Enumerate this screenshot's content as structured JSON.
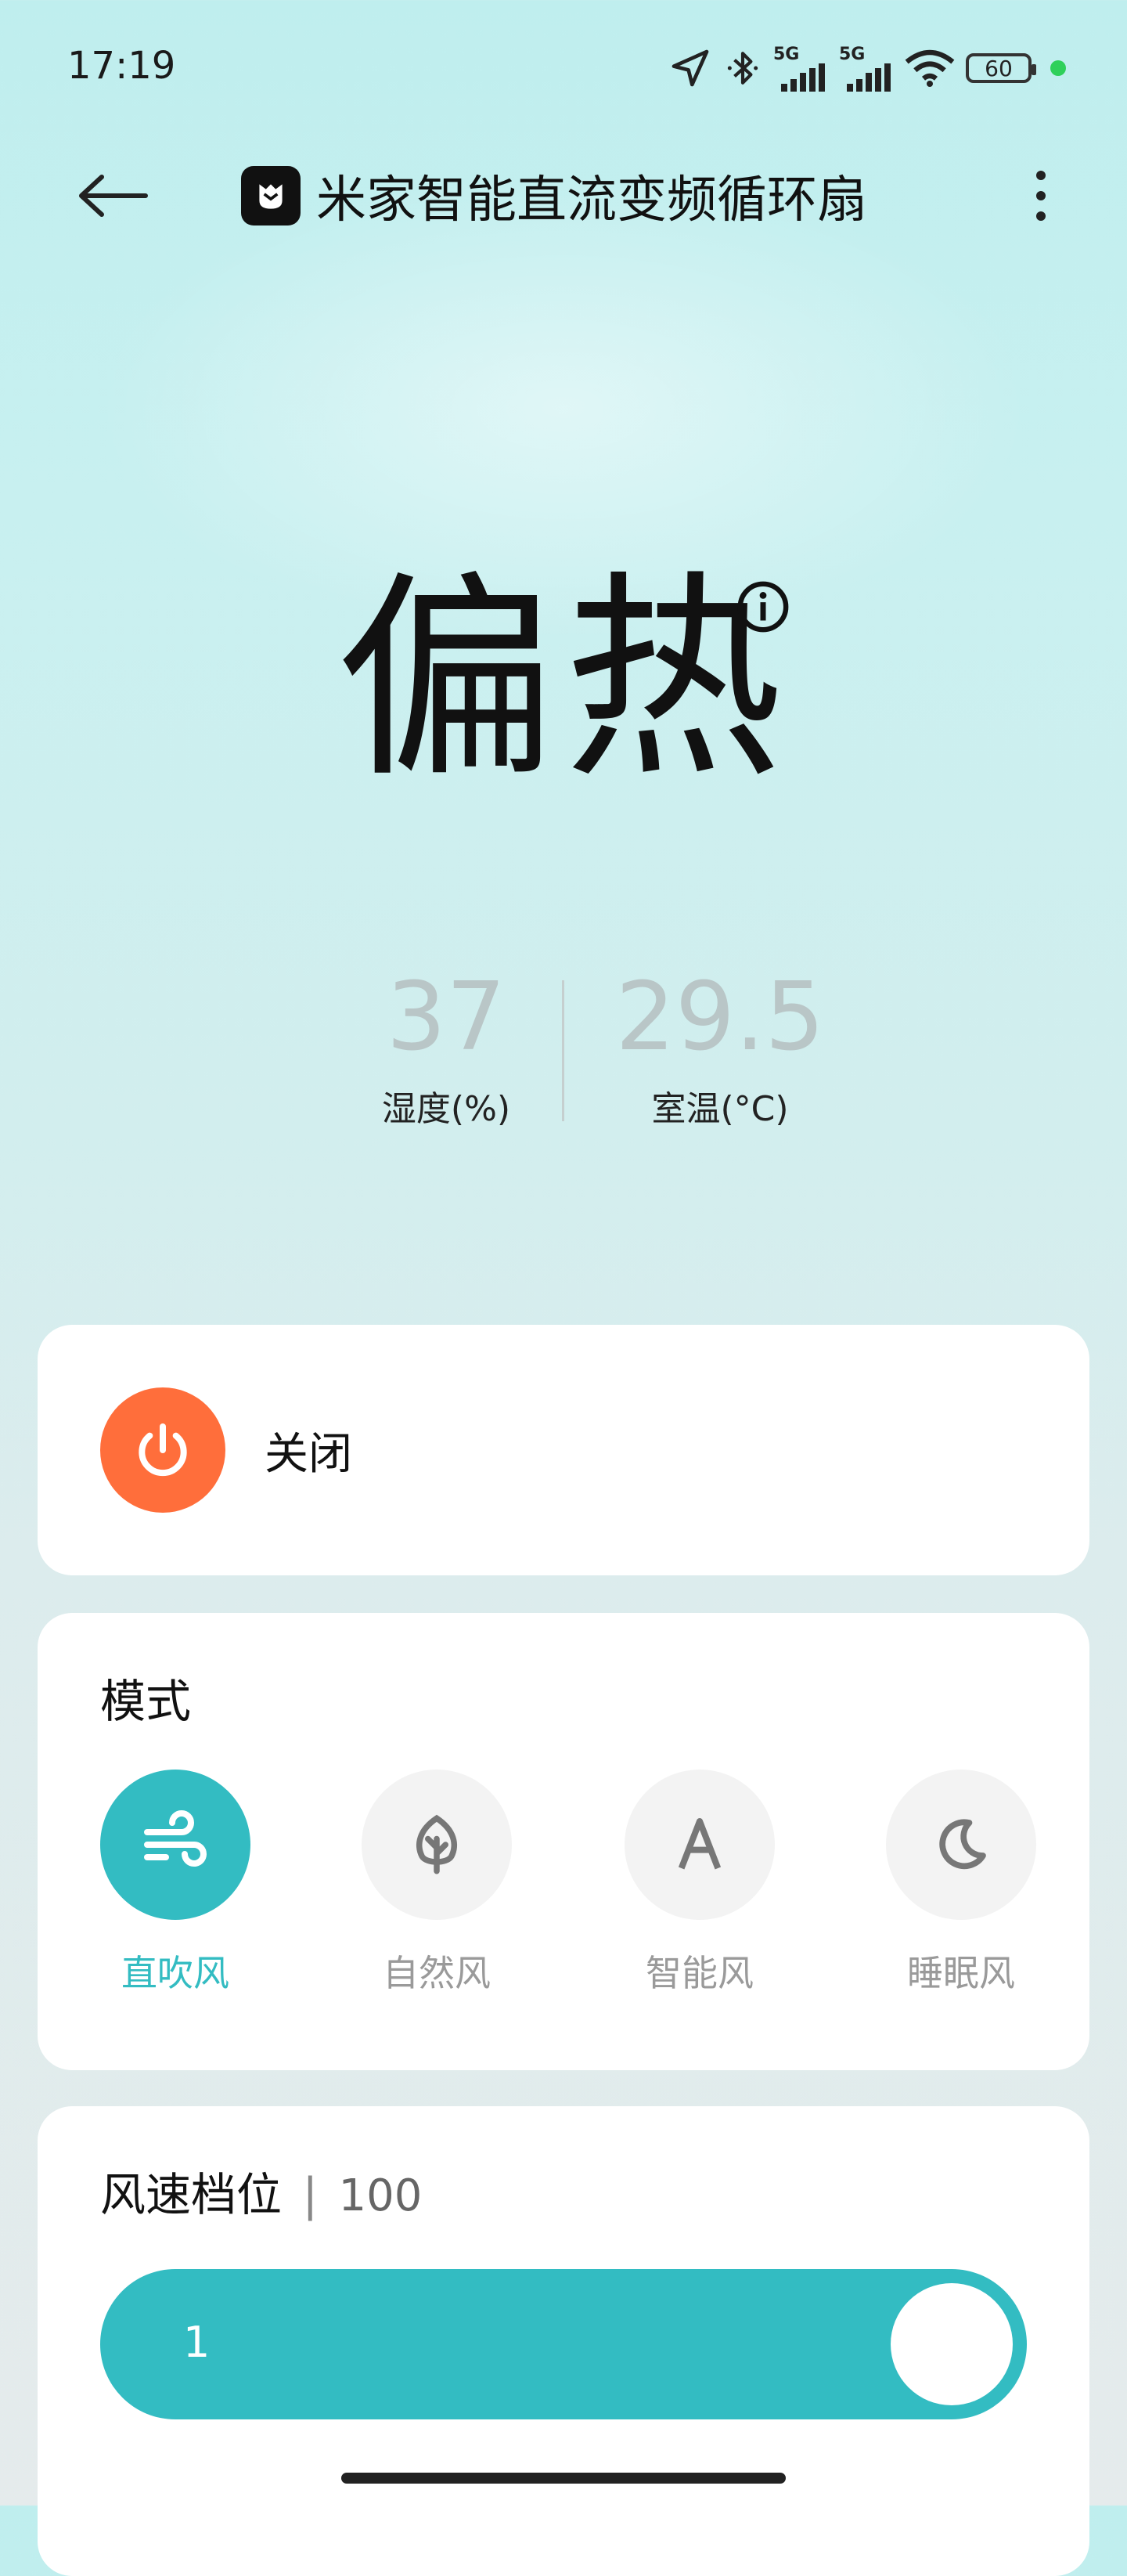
{
  "status_bar": {
    "time": "17:19",
    "network_1": "5G",
    "network_2": "5G",
    "battery": "60"
  },
  "header": {
    "title": "米家智能直流变频循环扇",
    "back_icon": "arrow-left-icon",
    "more_icon": "more-vertical-icon"
  },
  "comfort": {
    "text": "偏热",
    "info_icon": "info-icon"
  },
  "stats": {
    "humidity": {
      "value": "37",
      "label": "湿度(%)"
    },
    "temperature": {
      "value": "29.5",
      "label": "室温(°C)"
    }
  },
  "power": {
    "label": "关闭",
    "icon": "power-icon",
    "color": "#ff6e3b"
  },
  "mode": {
    "title": "模式",
    "items": [
      {
        "label": "直吹风",
        "icon": "wind-icon",
        "active": true
      },
      {
        "label": "自然风",
        "icon": "leaf-icon",
        "active": false
      },
      {
        "label": "智能风",
        "icon": "letter-a-icon",
        "active": false
      },
      {
        "label": "睡眠风",
        "icon": "moon-icon",
        "active": false
      }
    ]
  },
  "speed": {
    "title": "风速档位",
    "separator": "|",
    "value": "100",
    "slider_value": "1"
  },
  "colors": {
    "accent": "#33bcc2",
    "power": "#ff6e3b",
    "inactive_label": "#9a9a9a"
  }
}
